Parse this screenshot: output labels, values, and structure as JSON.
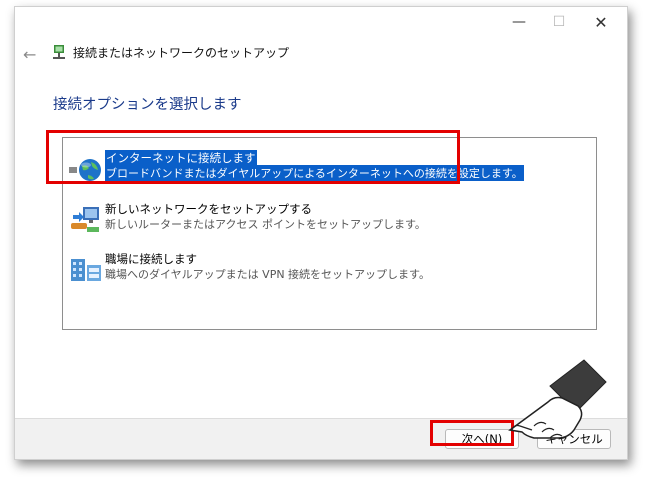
{
  "window": {
    "controls": {
      "minimize": "—",
      "maximize": "☐",
      "close": "✕"
    }
  },
  "nav": {
    "back": "←"
  },
  "app": {
    "title": "接続またはネットワークのセットアップ"
  },
  "page": {
    "heading": "接続オプションを選択します"
  },
  "options": [
    {
      "title": "インターネットに接続します",
      "desc": "ブロードバンドまたはダイヤルアップによるインターネットへの接続を設定します。",
      "icon": "globe-icon",
      "selected": true
    },
    {
      "title": "新しいネットワークをセットアップする",
      "desc": "新しいルーターまたはアクセス ポイントをセットアップします。",
      "icon": "router-icon",
      "selected": false
    },
    {
      "title": "職場に接続します",
      "desc": "職場へのダイヤルアップまたは VPN 接続をセットアップします。",
      "icon": "workplace-icon",
      "selected": false
    }
  ],
  "buttons": {
    "next": "次へ(N)",
    "cancel": "キャンセル"
  },
  "colors": {
    "heading": "#1a3a8a",
    "selection": "#0a5fc9",
    "annotation": "#e30000"
  }
}
